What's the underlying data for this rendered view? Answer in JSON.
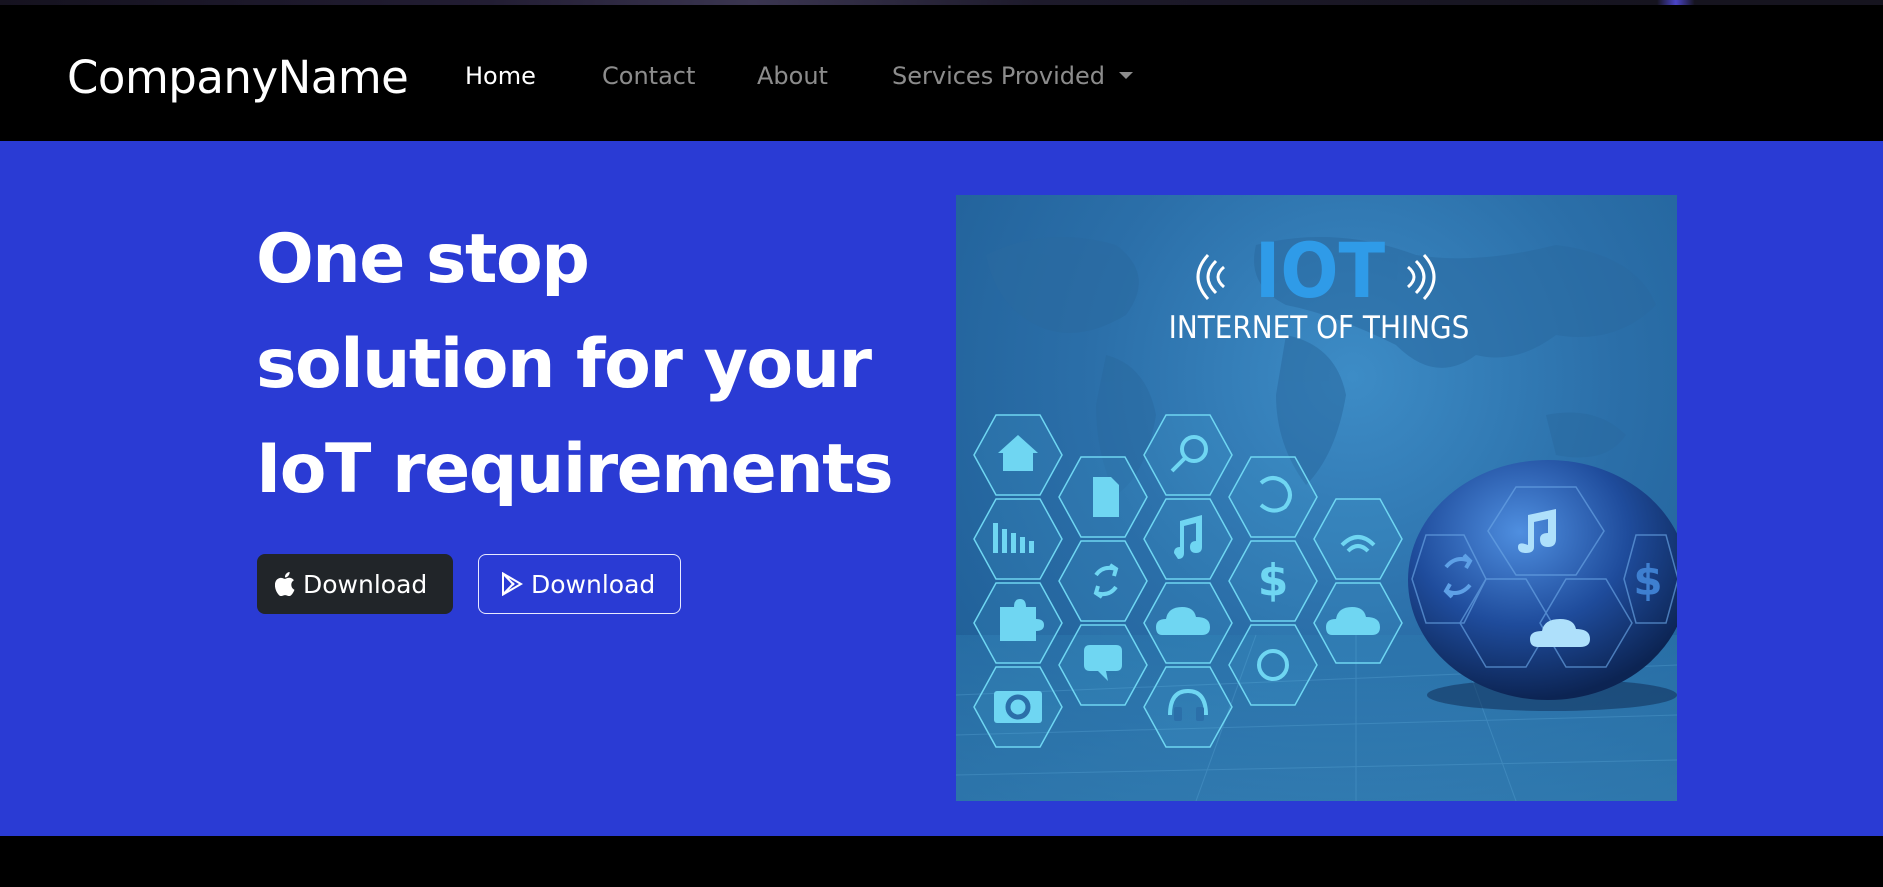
{
  "brand": {
    "name": "CompanyName"
  },
  "nav": {
    "items": [
      {
        "label": "Home",
        "active": true
      },
      {
        "label": "Contact"
      },
      {
        "label": "About"
      },
      {
        "label": "Services Provided",
        "dropdown": true
      }
    ]
  },
  "hero": {
    "headline_lines": [
      "One stop",
      "solution for your",
      "IoT requirements"
    ],
    "buttons": [
      {
        "label": "Download",
        "icon": "apple-icon",
        "style": "dark"
      },
      {
        "label": "Download",
        "icon": "google-play-icon",
        "style": "outline"
      }
    ],
    "image": {
      "title": "IOT",
      "subtitle": "INTERNET OF THINGS",
      "icons": [
        "home-icon",
        "document-icon",
        "search-icon",
        "refresh-icon",
        "chart-icon",
        "music-icon",
        "wifi-icon",
        "puzzle-icon",
        "sync-icon",
        "dollar-icon",
        "cloud-upload-icon",
        "chat-icon",
        "gear-icon",
        "camera-icon",
        "headphones-icon"
      ]
    }
  },
  "colors": {
    "hero_bg": "#2a3bd4",
    "nav_bg": "#000000",
    "dark_button": "#212529"
  }
}
